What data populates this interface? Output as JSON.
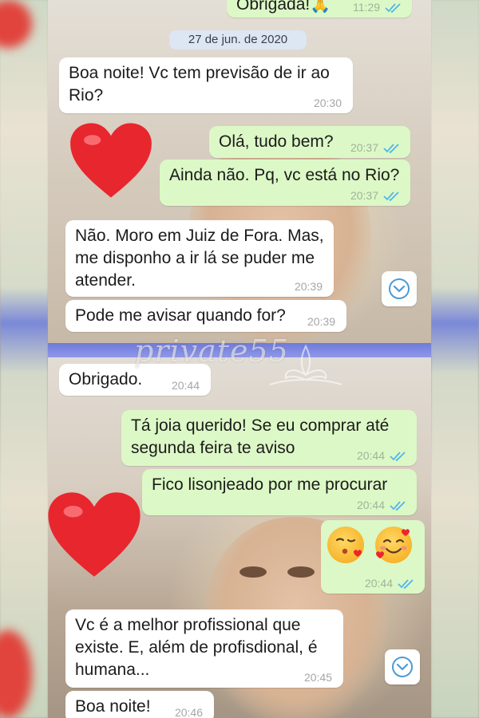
{
  "watermark": "private55",
  "date_separator": "27 de jun. de 2020",
  "colors": {
    "incoming_bubble": "#ffffff",
    "outgoing_bubble": "#dcf8c6",
    "read_ticks": "#4fb6ec",
    "heart": "#e8262e",
    "divider": "#7782dd"
  },
  "top_chat": {
    "messages": [
      {
        "direction": "out",
        "text": "Obrigada!🙏",
        "time": "11:29",
        "status": "read"
      },
      {
        "direction": "in",
        "text": "Boa noite! Vc tem previsão de ir ao Rio?",
        "time": "20:30"
      },
      {
        "direction": "out",
        "text": "Olá, tudo bem?",
        "time": "20:37",
        "status": "read"
      },
      {
        "direction": "out",
        "text": "Ainda não. Pq, vc está no Rio?",
        "time": "20:37",
        "status": "read"
      },
      {
        "direction": "in",
        "text": "Não. Moro em Juiz de Fora. Mas, me disponho a ir lá se puder me atender.",
        "time": "20:39"
      },
      {
        "direction": "in",
        "text": "Pode me avisar quando for?",
        "time": "20:39"
      }
    ],
    "scroll_icon": "chevron-down-icon",
    "decoration_icon": "red-heart-icon"
  },
  "bottom_chat": {
    "messages": [
      {
        "direction": "in",
        "text": "Obrigado.",
        "time": "20:44"
      },
      {
        "direction": "out",
        "text": "Tá joia querido! Se eu comprar até segunda feira te aviso",
        "time": "20:44",
        "status": "read"
      },
      {
        "direction": "out",
        "text": "Fico lisonjeado por me procurar",
        "time": "20:44",
        "status": "read"
      },
      {
        "direction": "out",
        "text": "",
        "emojis": [
          "kissing-face-with-heart-icon",
          "smiling-face-with-hearts-icon"
        ],
        "time": "20:44",
        "status": "read"
      },
      {
        "direction": "in",
        "text": "Vc é a melhor profissional que existe. E, além de profisdional, é humana...",
        "time": "20:45"
      },
      {
        "direction": "in",
        "text": "Boa noite!",
        "time": "20:46"
      }
    ],
    "scroll_icon": "chevron-down-icon",
    "decoration_icon": "red-heart-icon"
  }
}
